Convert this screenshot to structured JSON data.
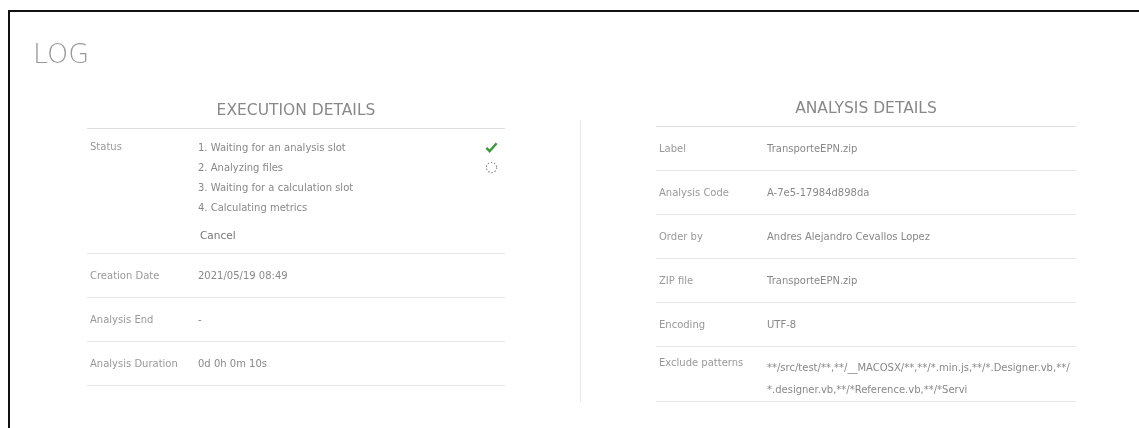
{
  "title": "LOG",
  "execution": {
    "heading": "EXECUTION DETAILS",
    "status_label": "Status",
    "steps": [
      {
        "text": "1. Waiting for an analysis slot",
        "done": true,
        "running": false
      },
      {
        "text": "2. Analyzing files",
        "done": false,
        "running": true
      },
      {
        "text": "3. Waiting for a calculation slot",
        "done": false,
        "running": false
      },
      {
        "text": "4. Calculating metrics",
        "done": false,
        "running": false
      }
    ],
    "cancel": "Cancel",
    "rows": [
      {
        "label": "Creation Date",
        "value": "2021/05/19 08:49"
      },
      {
        "label": "Analysis End",
        "value": "-"
      },
      {
        "label": "Analysis Duration",
        "value": "0d 0h 0m 10s"
      }
    ]
  },
  "analysis": {
    "heading": "ANALYSIS DETAILS",
    "rows": [
      {
        "label": "Label",
        "value": "TransporteEPN.zip"
      },
      {
        "label": "Analysis Code",
        "value": "A-7e5-17984d898da"
      },
      {
        "label": "Order by",
        "value": "Andres Alejandro Cevallos Lopez"
      },
      {
        "label": "ZIP file",
        "value": "TransporteEPN.zip"
      },
      {
        "label": "Encoding",
        "value": "UTF-8"
      },
      {
        "label": "Exclude patterns",
        "value": "**/src/test/**,**/__MACOSX/**,**/*.min.js,**/*.Designer.vb,**/*.designer.vb,**/*Reference.vb,**/*Servi"
      }
    ]
  }
}
